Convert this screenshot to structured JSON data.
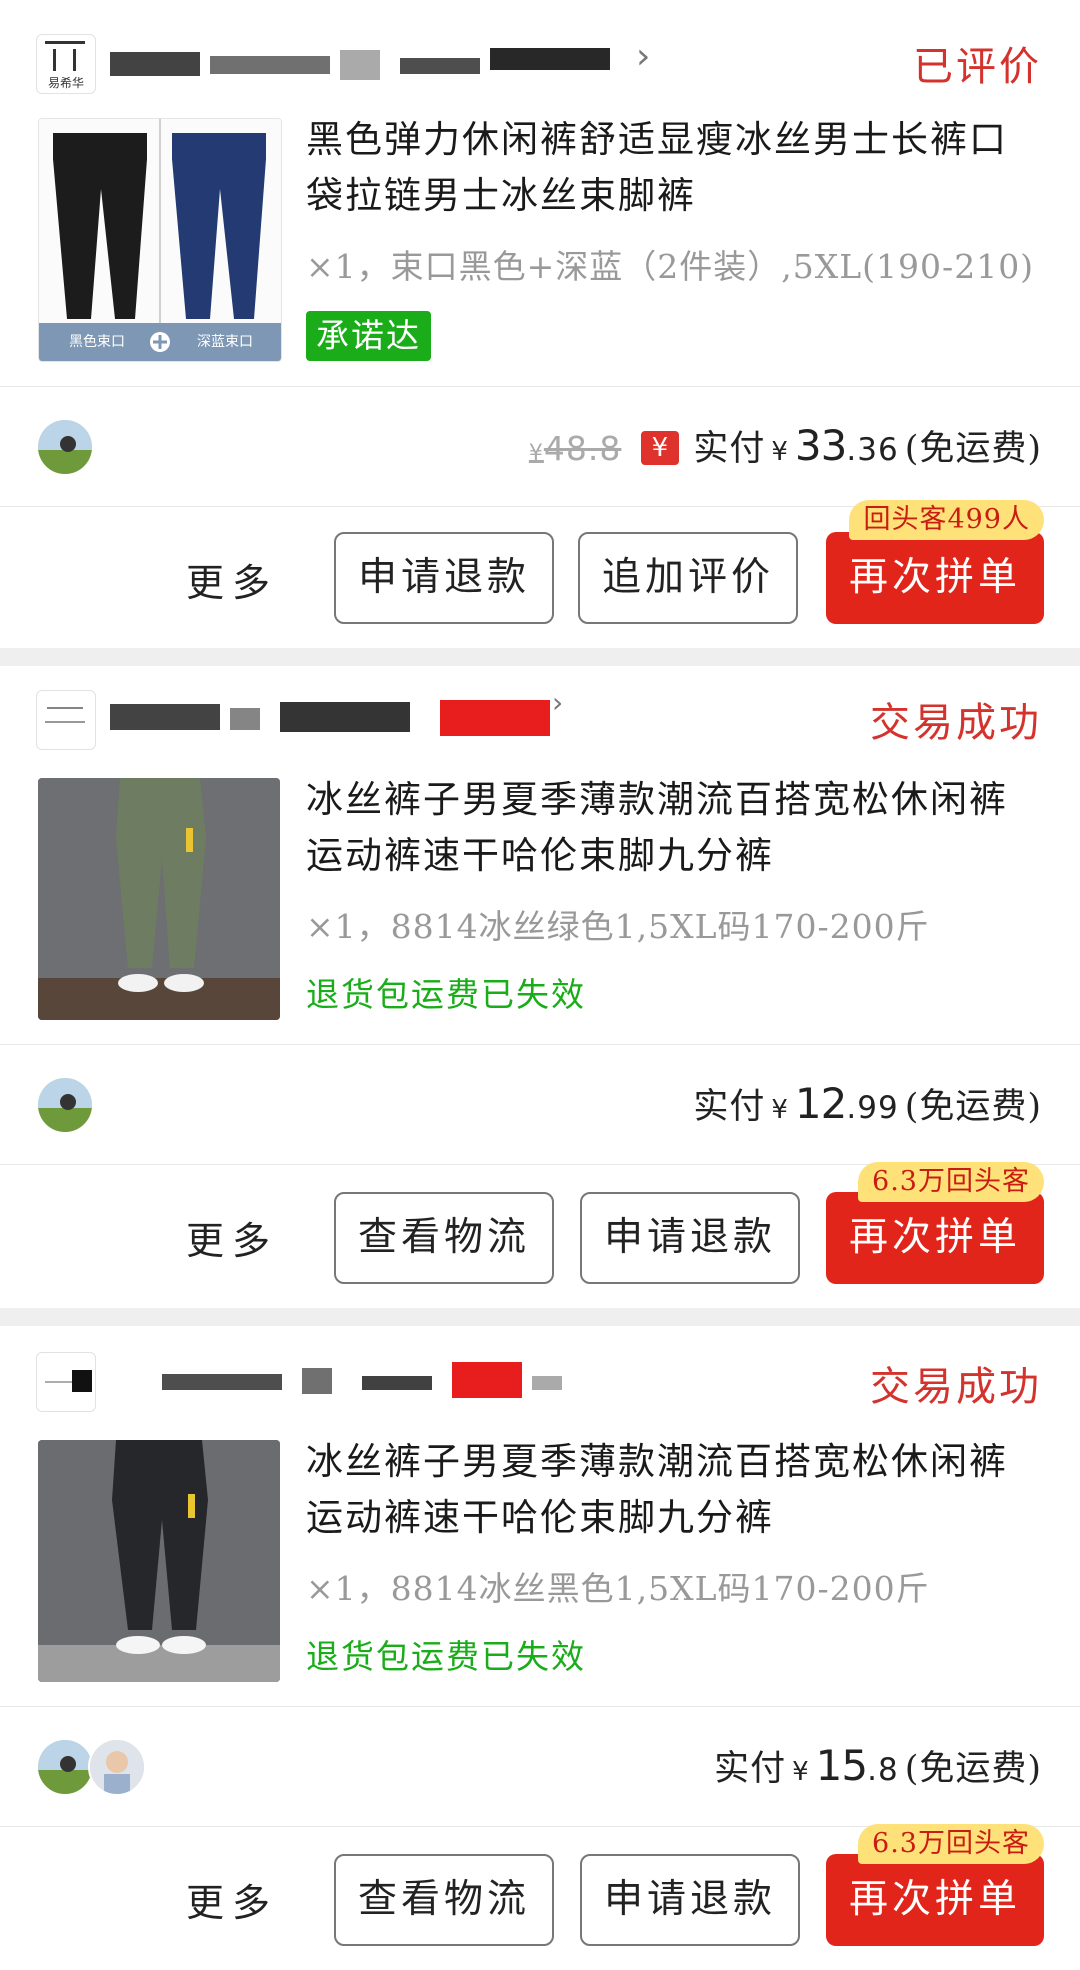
{
  "orders": [
    {
      "shop_logo_text": "易希华",
      "status": "已评价",
      "title": "黑色弹力休闲裤舒适显瘦冰丝男士长裤口袋拉链男士冰丝束脚裤",
      "spec": "×1，束口黑色+深蓝（2件装）,5XL(190-210)",
      "tag": "承诺达",
      "thumb_labels": [
        "黑色束口",
        "深蓝束口"
      ],
      "original_price": "48.8",
      "paid_label": "实付",
      "currency": "¥",
      "paid_int": "33",
      "paid_dec": ".36",
      "shipping": "(免运费)",
      "more": "更多",
      "buttons": [
        "申请退款",
        "追加评价"
      ],
      "primary": "再次拼单",
      "badge": "回头客499人"
    },
    {
      "status": "交易成功",
      "title": "冰丝裤子男夏季薄款潮流百搭宽松休闲裤运动裤速干哈伦束脚九分裤",
      "spec": "×1，8814冰丝绿色1,5XL码170-200斤",
      "notice": "退货包运费已失效",
      "paid_label": "实付",
      "currency": "¥",
      "paid_int": "12",
      "paid_dec": ".99",
      "shipping": "(免运费)",
      "more": "更多",
      "buttons": [
        "查看物流",
        "申请退款"
      ],
      "primary": "再次拼单",
      "badge": "6.3万回头客"
    },
    {
      "status": "交易成功",
      "title": "冰丝裤子男夏季薄款潮流百搭宽松休闲裤运动裤速干哈伦束脚九分裤",
      "spec": "×1，8814冰丝黑色1,5XL码170-200斤",
      "notice": "退货包运费已失效",
      "paid_label": "实付",
      "currency": "¥",
      "paid_int": "15",
      "paid_dec": ".8",
      "shipping": "(免运费)",
      "more": "更多",
      "buttons": [
        "查看物流",
        "申请退款"
      ],
      "primary": "再次拼单",
      "badge": "6.3万回头客"
    }
  ],
  "colors": {
    "status_red": "#d4322c",
    "primary_red": "#e1251b",
    "green": "#1aad19",
    "badge_yellow": "#ffe17a",
    "divider": "#efefef"
  }
}
